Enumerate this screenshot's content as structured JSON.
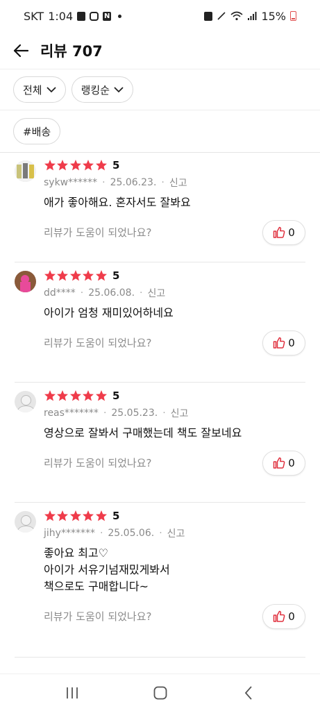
{
  "status_bar": {
    "carrier": "SKT",
    "time": "1:04",
    "battery": "15%"
  },
  "header": {
    "title": "리뷰 707"
  },
  "filters": [
    {
      "label": "전체"
    },
    {
      "label": "랭킹순"
    }
  ],
  "tags": [
    "#배송"
  ],
  "helpful_prompt": "리뷰가 도움이 되었나요?",
  "colors": {
    "star": "#ef3b4a",
    "like_icon": "#e0313f"
  },
  "reviews": [
    {
      "avatar": "photo-kids",
      "rating": 5,
      "score": "5",
      "user": "sykw******",
      "date": "25.06.23.",
      "report": "신고",
      "content": "애가  좋아해요. 혼자서도 잘봐요",
      "likes": "0"
    },
    {
      "avatar": "photo-pink",
      "rating": 5,
      "score": "5",
      "user": "dd****",
      "date": "25.06.08.",
      "report": "신고",
      "content": "아이가 엄청 재미있어하네요",
      "likes": "0"
    },
    {
      "avatar": "default",
      "rating": 5,
      "score": "5",
      "user": "reas*******",
      "date": "25.05.23.",
      "report": "신고",
      "content": "영상으로 잘봐서 구매했는데 책도 잘보네요",
      "likes": "0"
    },
    {
      "avatar": "default",
      "rating": 5,
      "score": "5",
      "user": "jihy*******",
      "date": "25.05.06.",
      "report": "신고",
      "content": "좋아요 최고♡\n아이가 서유기넘재밌게봐서\n책으로도 구매합니다~",
      "likes": "0"
    }
  ]
}
